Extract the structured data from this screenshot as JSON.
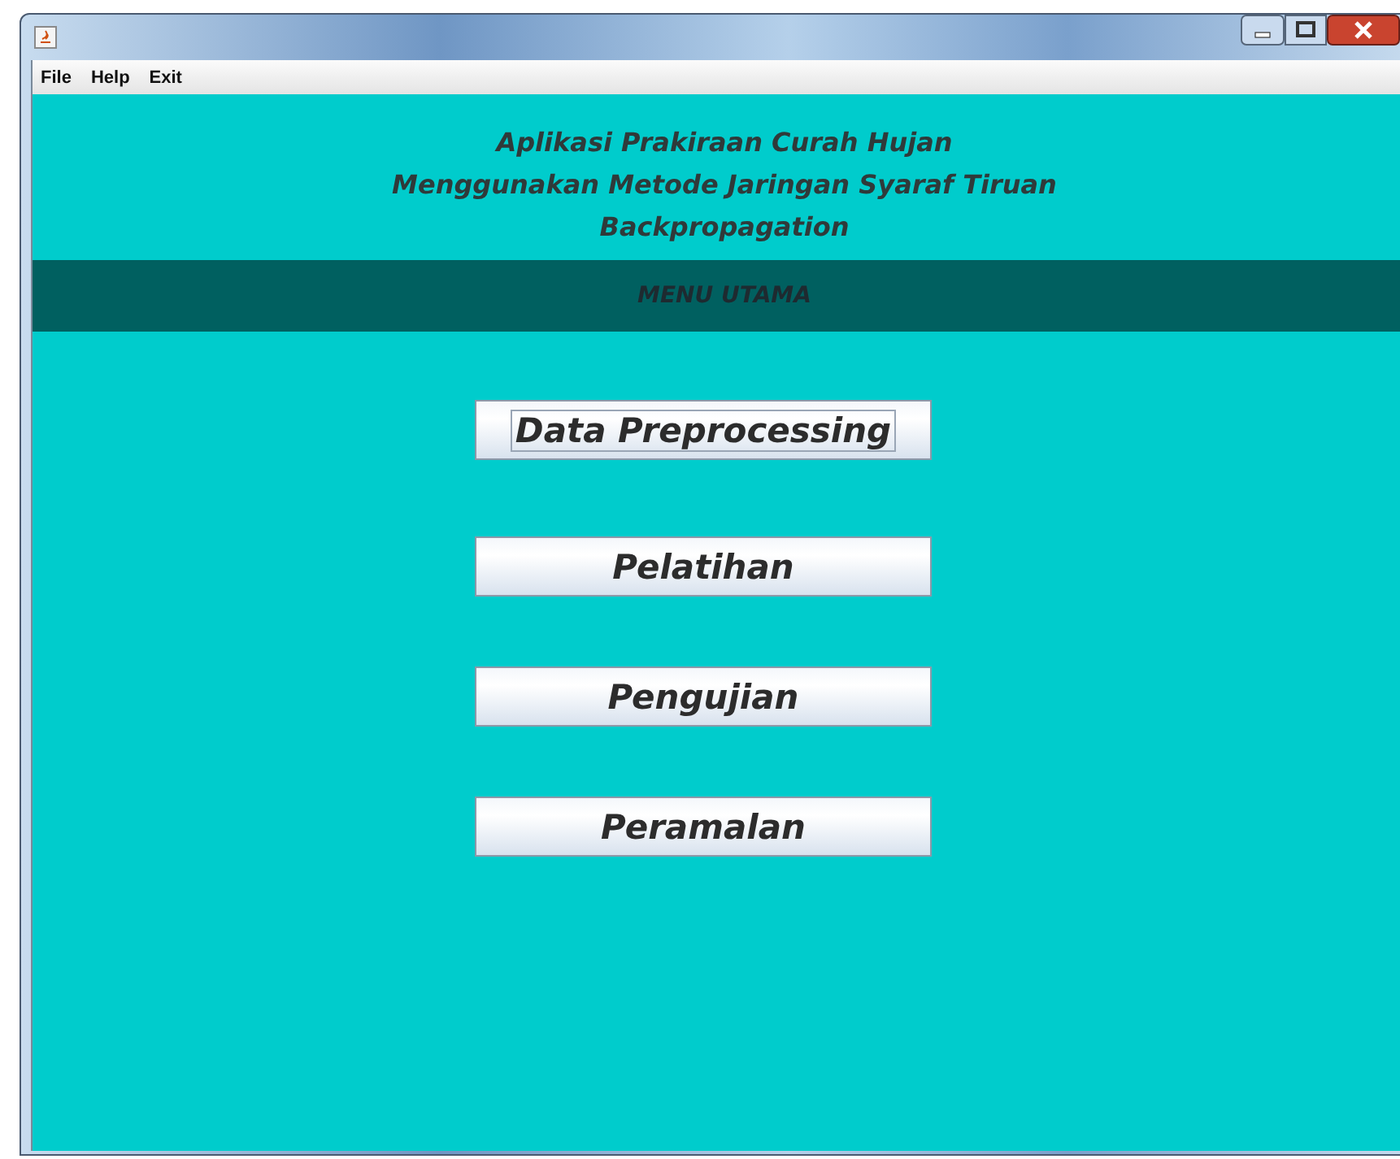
{
  "menu_bar": {
    "items": [
      "File",
      "Help",
      "Exit"
    ]
  },
  "header": {
    "lines": [
      "Aplikasi Prakiraan Curah Hujan",
      "Menggunakan Metode Jaringan Syaraf Tiruan",
      "Backpropagation"
    ]
  },
  "band": {
    "title": "MENU UTAMA"
  },
  "buttons": [
    {
      "label": "Data Preprocessing",
      "focused": true
    },
    {
      "label": "Pelatihan",
      "focused": false
    },
    {
      "label": "Pengujian",
      "focused": false
    },
    {
      "label": "Peramalan",
      "focused": false
    }
  ]
}
